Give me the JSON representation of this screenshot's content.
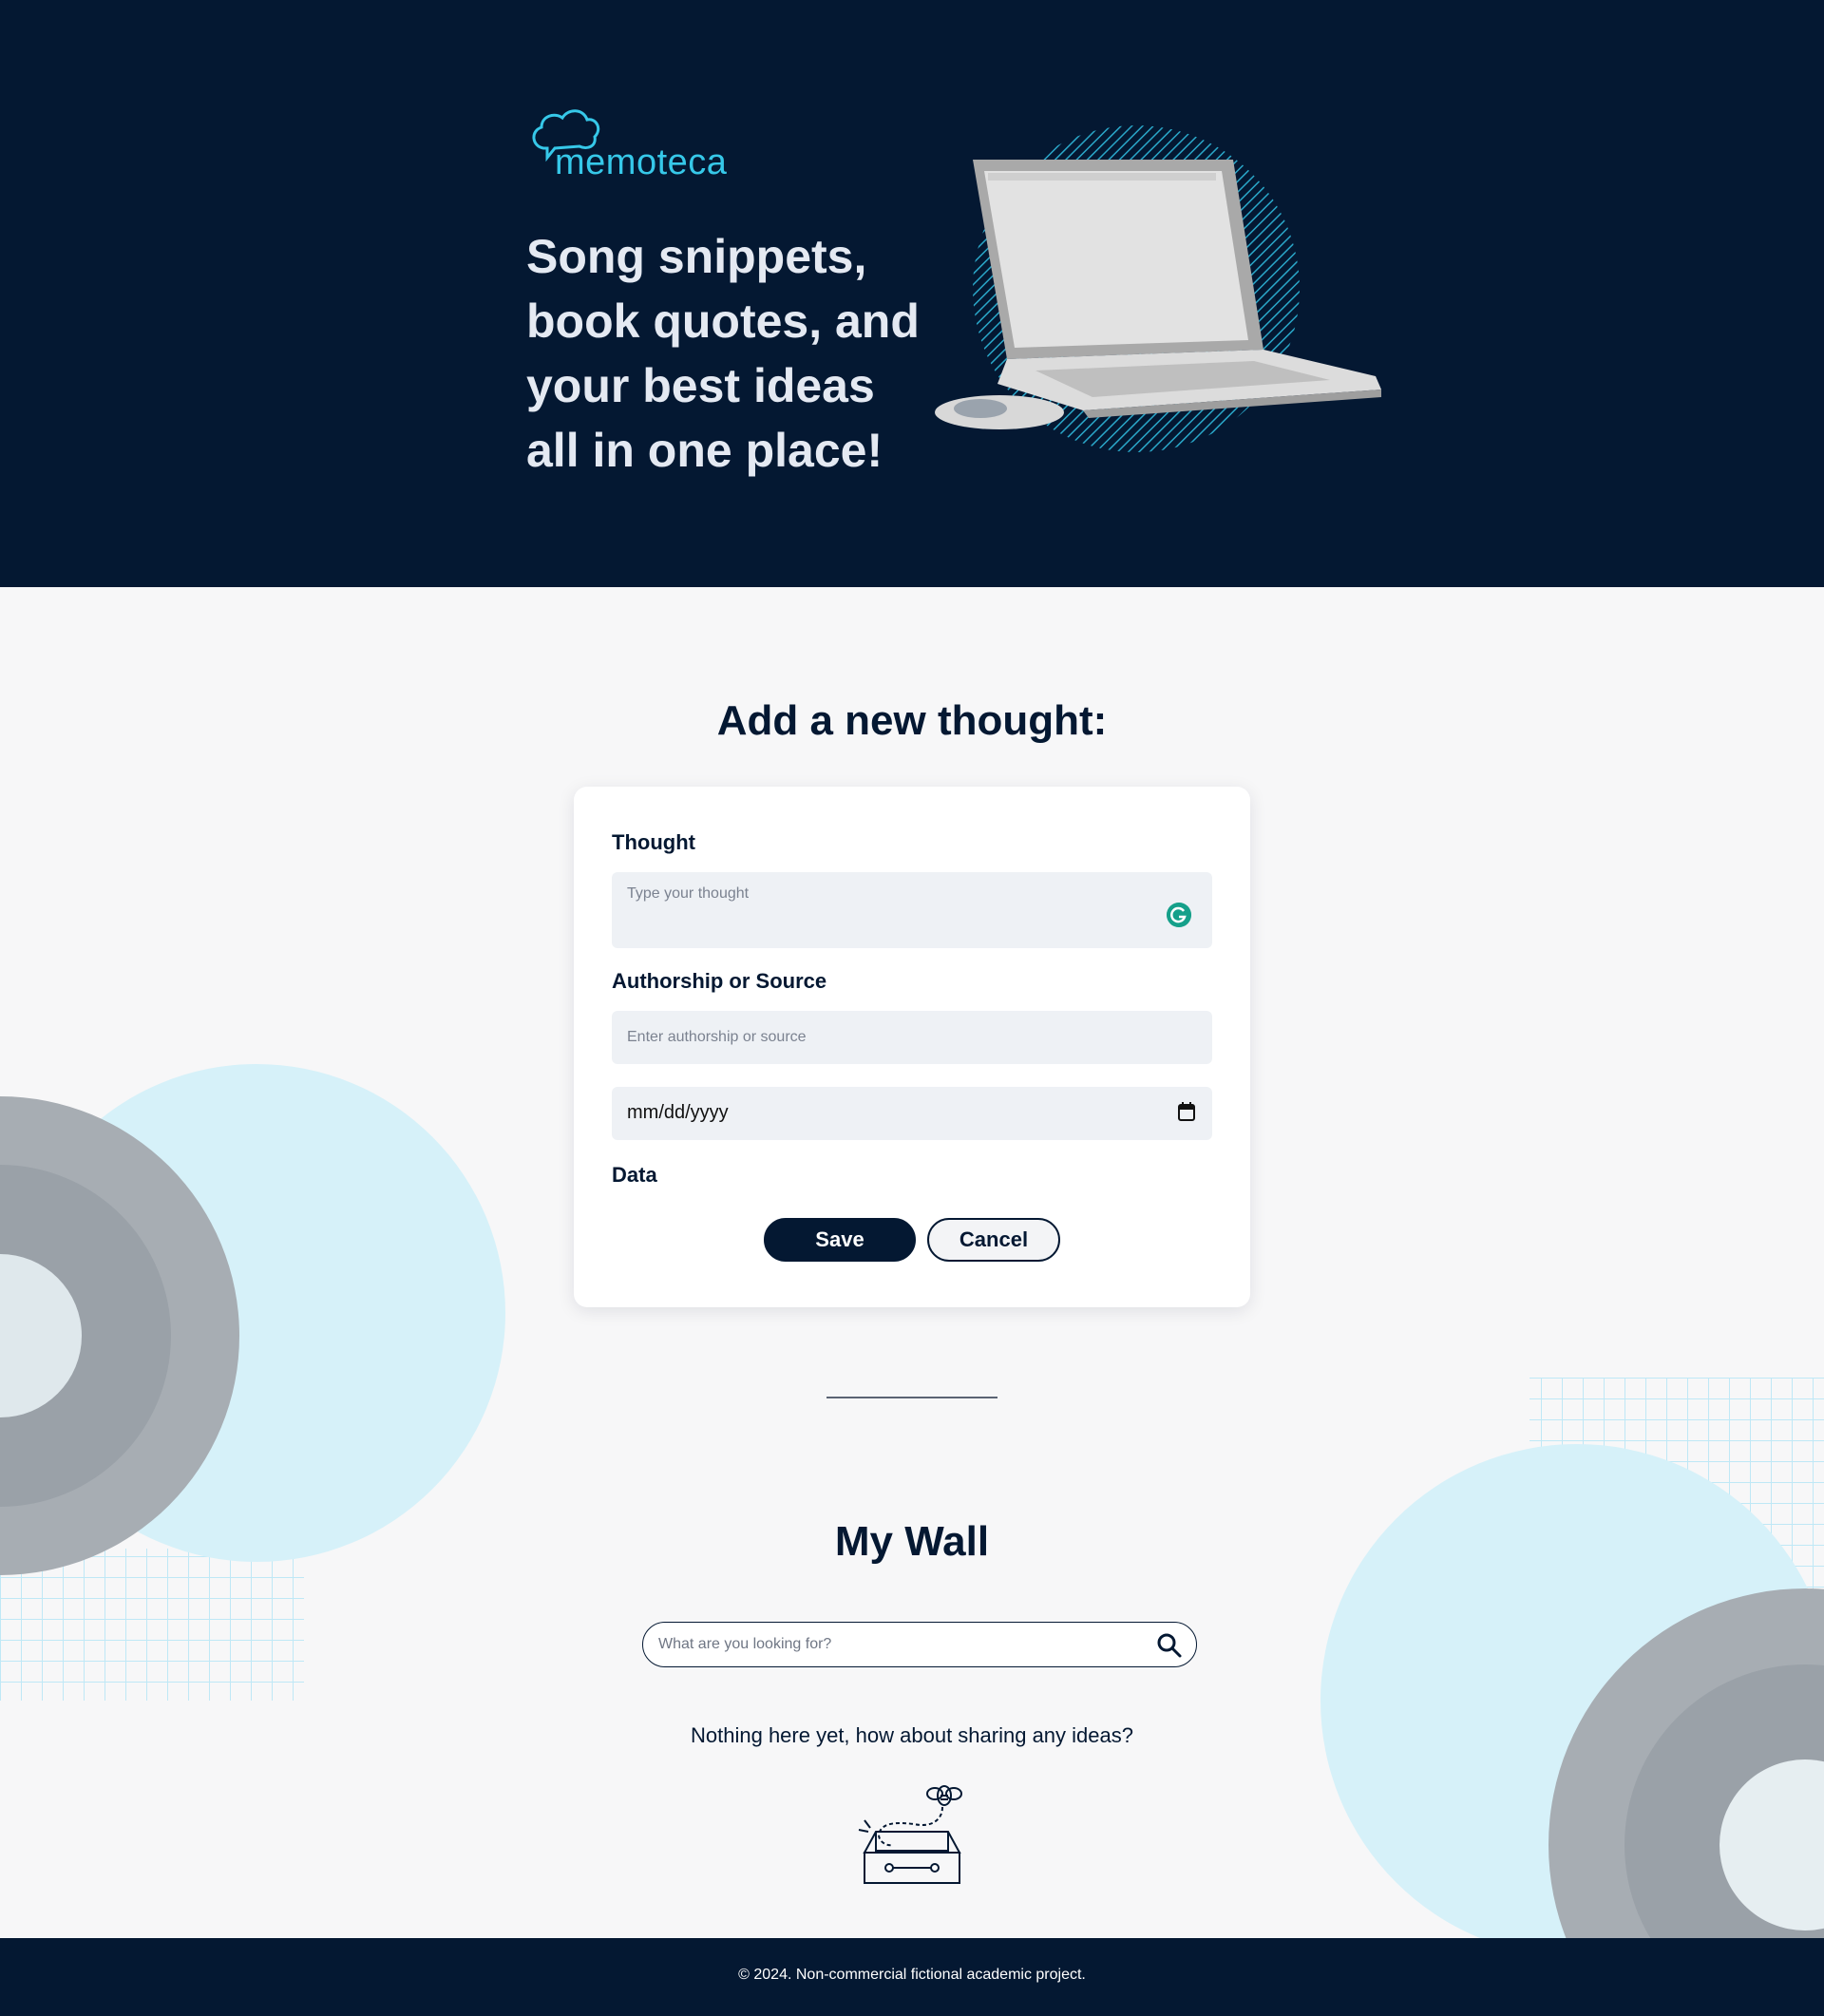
{
  "brand": {
    "name": "memoteca",
    "accent_color": "#36c8e9",
    "dark_color": "#041832"
  },
  "hero": {
    "line1": "Song snippets,",
    "line2": "book quotes, and",
    "line3": "your best ideas",
    "line4": "all in one place!",
    "illustration": "laptop-and-mouse"
  },
  "form": {
    "title": "Add a new thought:",
    "thought_label": "Thought",
    "thought_placeholder": "Type your thought",
    "author_label": "Authorship or Source",
    "author_placeholder": "Enter authorship or source",
    "date_value": "mm/dd/yyyy",
    "date_label": "Data",
    "save_label": "Save",
    "cancel_label": "Cancel"
  },
  "wall": {
    "title": "My Wall",
    "search_placeholder": "What are you looking for?",
    "empty_message": "Nothing here yet, how about sharing any ideas?",
    "empty_illustration": "empty-box-with-bee"
  },
  "footer": {
    "text": "© 2024. Non-commercial fictional academic project."
  },
  "icons": [
    "cloud-logo-icon",
    "grammarly-icon",
    "calendar-icon",
    "search-icon"
  ]
}
